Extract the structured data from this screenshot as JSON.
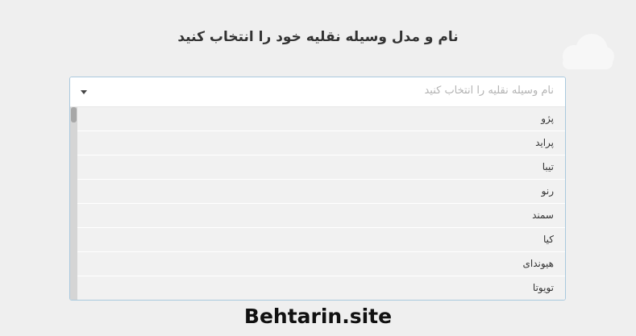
{
  "heading": "نام و مدل وسیله نقلیه خود را انتخاب کنید",
  "select": {
    "placeholder": "نام وسیله نقلیه را انتخاب کنید",
    "options": [
      "پژو",
      "پراید",
      "تیبا",
      "رنو",
      "سمند",
      "کیا",
      "هیوندای",
      "تویوتا"
    ]
  },
  "watermark": "Behtarin.site",
  "icons": {
    "dropdown": "caret-down-icon",
    "decoration": "cloud-icon"
  },
  "colors": {
    "background": "#efefef",
    "border": "#a9c9de",
    "option_bg": "#f1f1f1"
  }
}
